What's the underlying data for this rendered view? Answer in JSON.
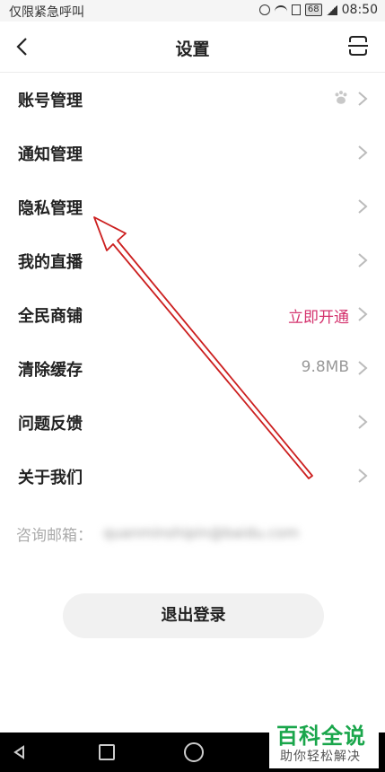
{
  "status": {
    "carrier": "仅限紧急呼叫",
    "battery": "68",
    "time": "08:50"
  },
  "header": {
    "title": "设置"
  },
  "settings": {
    "items": [
      {
        "label": "账号管理",
        "value": ""
      },
      {
        "label": "通知管理",
        "value": ""
      },
      {
        "label": "隐私管理",
        "value": ""
      },
      {
        "label": "我的直播",
        "value": ""
      },
      {
        "label": "全民商铺",
        "value": "立即开通"
      },
      {
        "label": "清除缓存",
        "value": "9.8MB"
      },
      {
        "label": "问题反馈",
        "value": ""
      },
      {
        "label": "关于我们",
        "value": ""
      }
    ],
    "accent_color": "#d4336e"
  },
  "contact": {
    "label": "咨询邮箱：",
    "value": "quanminshipin@baidu.com"
  },
  "logout": {
    "label": "退出登录"
  },
  "watermark": {
    "title": "百科全说",
    "subtitle": "助你轻松解决"
  },
  "annotation": {
    "color": "#cc1f1f"
  }
}
